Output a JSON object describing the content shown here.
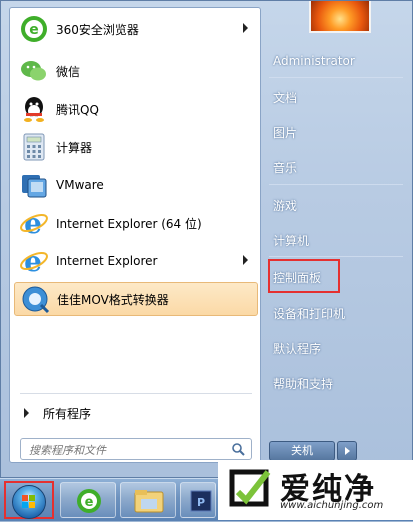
{
  "left_menu": {
    "items": [
      {
        "label": "360安全浏览器",
        "icon": "360-browser-icon",
        "has_arrow": true
      },
      {
        "label": "微信",
        "icon": "wechat-icon",
        "has_arrow": false
      },
      {
        "label": "腾讯QQ",
        "icon": "qq-icon",
        "has_arrow": false
      },
      {
        "label": "计算器",
        "icon": "calculator-icon",
        "has_arrow": false
      },
      {
        "label": "VMware",
        "icon": "vmware-icon",
        "has_arrow": false
      },
      {
        "label": "Internet Explorer (64 位)",
        "icon": "ie-icon",
        "has_arrow": false
      },
      {
        "label": "Internet Explorer",
        "icon": "ie-icon",
        "has_arrow": true
      },
      {
        "label": "佳佳MOV格式转换器",
        "icon": "mov-converter-icon",
        "has_arrow": false,
        "highlighted": true
      }
    ],
    "all_programs": "所有程序"
  },
  "search": {
    "placeholder": "搜索程序和文件"
  },
  "right_menu": {
    "items": [
      "Administrator",
      "文档",
      "图片",
      "音乐",
      "游戏",
      "计算机",
      "控制面板",
      "设备和打印机",
      "默认程序",
      "帮助和支持"
    ],
    "highlighted_item": "控制面板",
    "highlight_color": "#e53030"
  },
  "shutdown": {
    "label": "关机"
  },
  "taskbar": {
    "buttons": [
      "start-orb",
      "360-browser-icon",
      "file-explorer-icon",
      "ps-icon"
    ]
  },
  "watermark": {
    "text": "爱纯净",
    "url": "www.aichunjing.com"
  }
}
